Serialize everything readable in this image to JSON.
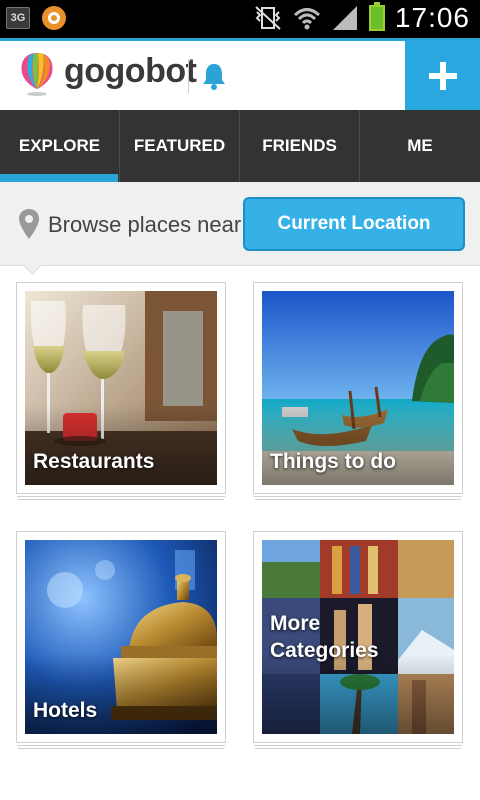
{
  "status_bar": {
    "network_badge": "3G",
    "time": "17:06"
  },
  "header": {
    "brand": "gogobot",
    "icons": [
      "logo-balloon-icon",
      "bell-icon",
      "plus-icon"
    ],
    "accent_color": "#29a8e0"
  },
  "tabs": [
    {
      "label": "EXPLORE",
      "active": true
    },
    {
      "label": "FEATURED",
      "active": false
    },
    {
      "label": "FRIENDS",
      "active": false
    },
    {
      "label": "ME",
      "active": false
    }
  ],
  "browse": {
    "label": "Browse places near",
    "button_label": "Current Location"
  },
  "categories": [
    {
      "label": "Restaurants"
    },
    {
      "label": "Things to do"
    },
    {
      "label": "Hotels"
    },
    {
      "label": "More Categories"
    }
  ]
}
